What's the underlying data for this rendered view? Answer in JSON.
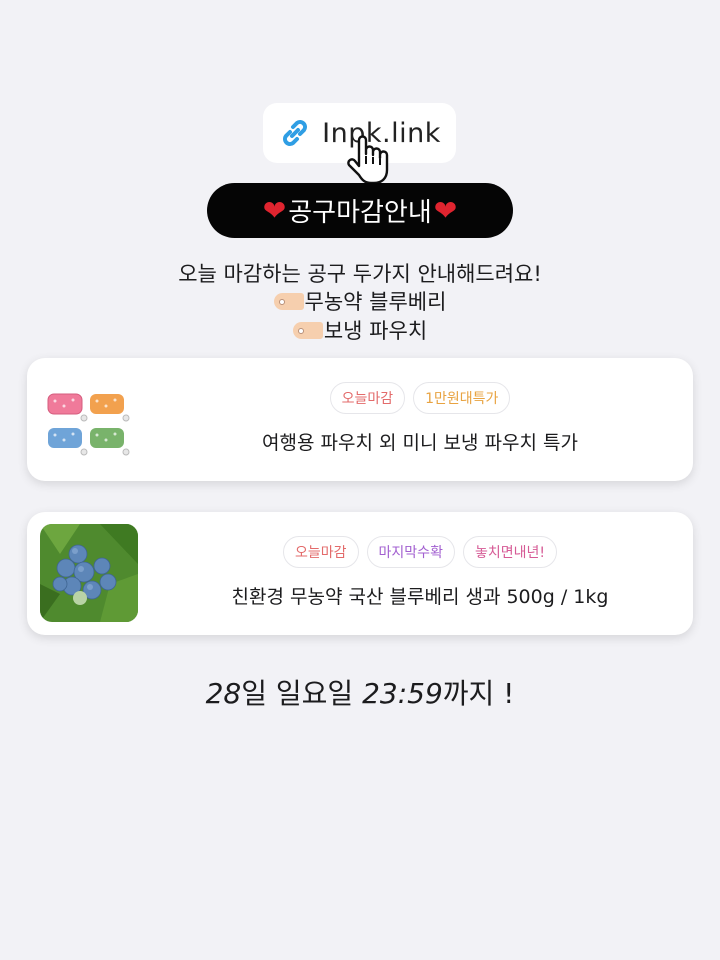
{
  "logo": {
    "text": "Inpk.link",
    "icons": [
      "link-icon",
      "hand-cursor-icon"
    ]
  },
  "banner": {
    "title": "공구마감안내",
    "heart_icon": "heart-icon",
    "heart_color": "#e0242f"
  },
  "intro": {
    "line1": "오늘 마감하는 공구 두가지 안내해드려요!",
    "items": [
      "무농약 블루베리",
      "보냉 파우치"
    ],
    "bullet_icon": "tag-icon"
  },
  "products": [
    {
      "badges": [
        "오늘마감",
        "1만원대특가"
      ],
      "title": "여행용 파우치 외 미니 보냉 파우치 특가",
      "image": "pouches-thumbnail"
    },
    {
      "badges": [
        "오늘마감",
        "마지막수확",
        "놓치면내년!"
      ],
      "title": "친환경 무농약 국산 블루베리 생과 500g / 1kg",
      "image": "blueberry-thumbnail"
    }
  ],
  "deadline": {
    "day_num": "28",
    "day_text": "일 일요일 ",
    "time": "23:59",
    "suffix": "까지 !"
  }
}
